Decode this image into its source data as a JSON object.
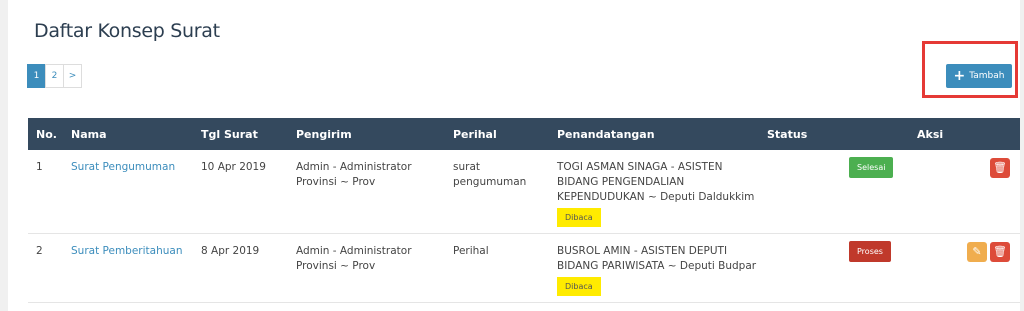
{
  "page_title": "Daftar Konsep Surat",
  "pagination": {
    "pages": [
      "1",
      "2"
    ],
    "next": ">"
  },
  "add_button": {
    "label": "Tambah"
  },
  "columns": [
    "No.",
    "Nama",
    "Tgl Surat",
    "Pengirim",
    "Perihal",
    "Penandatangan",
    "Status",
    "Aksi"
  ],
  "rows": [
    {
      "no": "1",
      "nama": "Surat Pengumuman",
      "tgl": "10 Apr 2019",
      "pengirim": "Admin - Administrator Provinsi ~ Prov",
      "perihal": "surat pengumuman",
      "penandatangan": "TOGI ASMAN SINAGA - ASISTEN BIDANG PENGENDALIAN KEPENDUDUKAN ~ Deputi Daldukkim",
      "read_tag": "Dibaca",
      "status": "Selesai",
      "status_color": "#4caf50"
    },
    {
      "no": "2",
      "nama": "Surat Pemberitahuan",
      "tgl": "8 Apr 2019",
      "pengirim": "Admin - Administrator Provinsi ~ Prov",
      "perihal": "Perihal",
      "penandatangan": "BUSROL AMIN - ASISTEN DEPUTI BIDANG PARIWISATA ~ Deputi Budpar",
      "read_tag": "Dibaca",
      "status": "Proses",
      "status_color": "#c0392b"
    }
  ]
}
